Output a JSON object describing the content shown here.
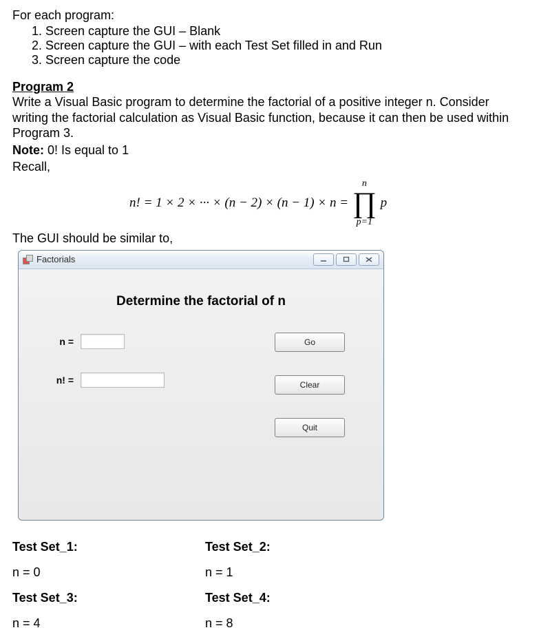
{
  "intro": {
    "lead": "For each program:",
    "steps": [
      "Screen capture the GUI – Blank",
      "Screen capture the GUI – with each Test Set filled in and Run",
      "Screen capture the code"
    ]
  },
  "program": {
    "heading": "Program 2",
    "description": "Write a Visual Basic program to determine the factorial of a positive integer n. Consider writing the factorial calculation as Visual Basic function, because it can then be used within Program 3.",
    "note_label": "Note:",
    "note_text": " 0! Is equal to 1",
    "recall": "Recall,"
  },
  "formula": {
    "lhs": "n!  = 1 × 2 × ··· × (n − 2) × (n − 1) × n  =",
    "prod_top": "n",
    "prod_symbol": "∏",
    "prod_bottom": "p=1",
    "prod_term": "p"
  },
  "gui_lead": "The GUI should be similar to,",
  "window": {
    "title": "Factorials",
    "heading": "Determine the factorial of n",
    "label_n": "n =",
    "label_nf": "n! =",
    "btn_go": "Go",
    "btn_clear": "Clear",
    "btn_quit": "Quit"
  },
  "testsets": [
    {
      "title": "Test Set_1:",
      "value": "n = 0"
    },
    {
      "title": "Test Set_2:",
      "value": "n = 1"
    },
    {
      "title": "Test Set_3:",
      "value": "n = 4"
    },
    {
      "title": "Test Set_4:",
      "value": "n = 8"
    }
  ]
}
